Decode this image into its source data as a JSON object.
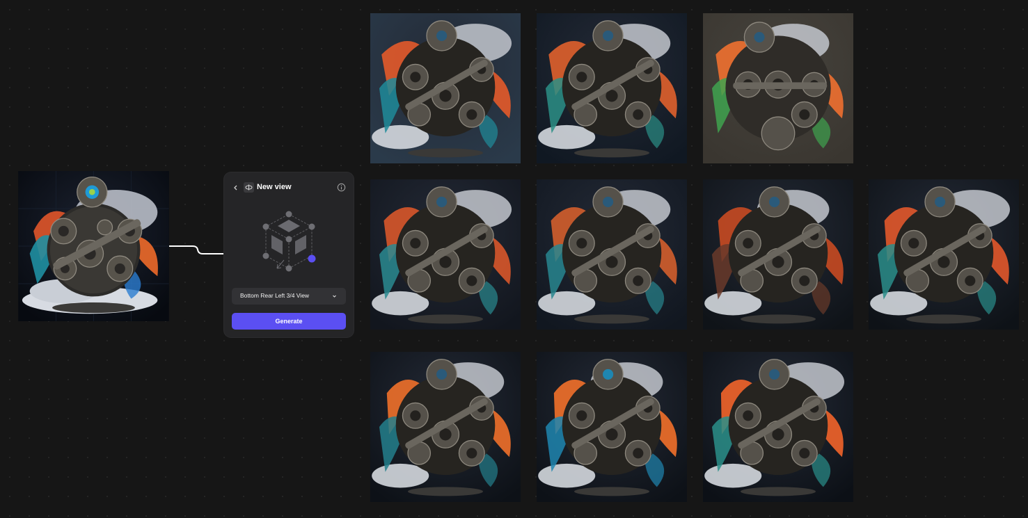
{
  "panel": {
    "title": "New view",
    "view_select": {
      "value": "Bottom Rear Left 3/4 View"
    },
    "generate_label": "Generate"
  },
  "images": {
    "source": {
      "icon": "gear-sculpture-image"
    },
    "results": [
      {
        "icon": "gear-sculpture-image"
      },
      {
        "icon": "gear-sculpture-image"
      },
      {
        "icon": "gear-sculpture-image"
      },
      {
        "icon": "gear-sculpture-image"
      },
      {
        "icon": "gear-sculpture-image"
      },
      {
        "icon": "gear-sculpture-image"
      },
      {
        "icon": "gear-sculpture-image"
      },
      {
        "icon": "gear-sculpture-image"
      },
      {
        "icon": "gear-sculpture-image"
      },
      {
        "icon": "gear-sculpture-image"
      }
    ]
  },
  "colors": {
    "canvas": "#161616",
    "panel": "#252527",
    "accent": "#5b4ff2",
    "active_dot": "#5b4ff2"
  }
}
